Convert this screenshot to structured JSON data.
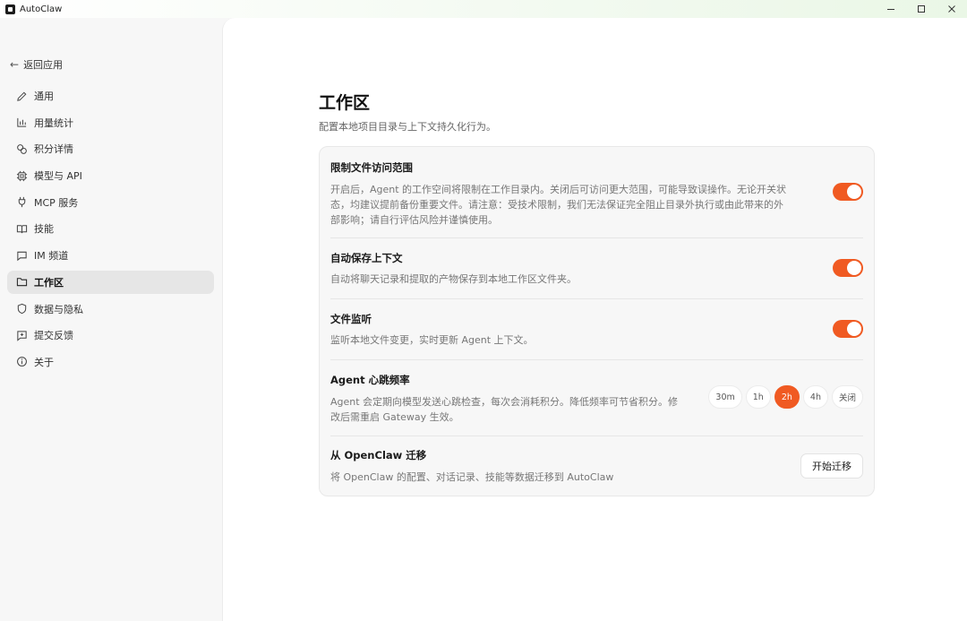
{
  "window": {
    "title": "AutoClaw"
  },
  "sidebar": {
    "back_label": "返回应用",
    "items": [
      {
        "label": "通用",
        "icon": "pencil-icon"
      },
      {
        "label": "用量统计",
        "icon": "bar-chart-icon"
      },
      {
        "label": "积分详情",
        "icon": "coins-icon"
      },
      {
        "label": "模型与 API",
        "icon": "chip-icon"
      },
      {
        "label": "MCP 服务",
        "icon": "plug-icon"
      },
      {
        "label": "技能",
        "icon": "book-icon"
      },
      {
        "label": "IM 频道",
        "icon": "chat-icon"
      },
      {
        "label": "工作区",
        "icon": "folder-icon",
        "active": true
      },
      {
        "label": "数据与隐私",
        "icon": "shield-icon"
      },
      {
        "label": "提交反馈",
        "icon": "feedback-icon"
      },
      {
        "label": "关于",
        "icon": "info-icon"
      }
    ]
  },
  "main": {
    "title": "工作区",
    "subtitle": "配置本地项目目录与上下文持久化行为。",
    "settings": {
      "restrict": {
        "title": "限制文件访问范围",
        "desc_line1": "开启后，Agent 的工作空间将限制在工作目录内。关闭后可访问更大范围，可能导致误操作。无论开关状",
        "desc_line2": "态，均建议提前备份重要文件。请注意：受技术限制，我们无法保证完全阻止目录外执行或由此带来的外",
        "desc_line3": "部影响；请自行评估风险并谨慎使用。",
        "enabled": true
      },
      "autosave": {
        "title": "自动保存上下文",
        "desc": "自动将聊天记录和提取的产物保存到本地工作区文件夹。",
        "enabled": true
      },
      "watch": {
        "title": "文件监听",
        "desc": "监听本地文件变更，实时更新 Agent 上下文。",
        "enabled": true
      },
      "heartbeat": {
        "title": "Agent 心跳频率",
        "desc_line1": "Agent 会定期向模型发送心跳检查，每次会消耗积分。降低频率可节省积分。修",
        "desc_line2": "改后需重启 Gateway 生效。",
        "options": [
          "30m",
          "1h",
          "2h",
          "4h",
          "关闭"
        ],
        "selected": "2h"
      },
      "migrate": {
        "title": "从 OpenClaw 迁移",
        "desc": "将 OpenClaw 的配置、对话记录、技能等数据迁移到 AutoClaw",
        "button": "开始迁移"
      }
    }
  },
  "colors": {
    "accent": "#f05a22"
  }
}
